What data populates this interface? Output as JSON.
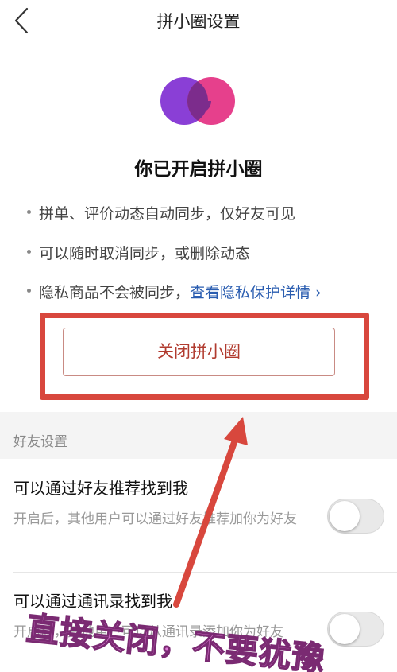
{
  "header": {
    "title": "拼小圈设置"
  },
  "intro": {
    "headline": "你已开启拼小圈",
    "bullets": [
      {
        "text": "拼单、评价动态自动同步，仅好友可见"
      },
      {
        "text": "可以随时取消同步，或删除动态"
      },
      {
        "text": "隐私商品不会被同步，",
        "link": "查看隐私保护详情 ›"
      }
    ]
  },
  "close_button": {
    "label": "关闭拼小圈"
  },
  "friend_settings": {
    "section_label": "好友设置",
    "rows": [
      {
        "title": "可以通过好友推荐找到我",
        "desc": "开启后，其他用户可以通过好友推荐加你为好友",
        "enabled": false
      },
      {
        "title": "可以通过通讯录找到我",
        "desc": "开启后，其他用户可以从通讯录添加你为好友",
        "enabled": false
      }
    ]
  },
  "annotation": {
    "text": "直接关闭，不要犹豫"
  },
  "colors": {
    "accent_red": "#b13b2f",
    "annotation_frame": "#d8473d",
    "link_blue": "#2a5db0",
    "annotation_text": "#e07bd8"
  },
  "icons": {
    "back": "back-chevron-icon",
    "logo": "pinxiaoquan-logo-icon"
  }
}
